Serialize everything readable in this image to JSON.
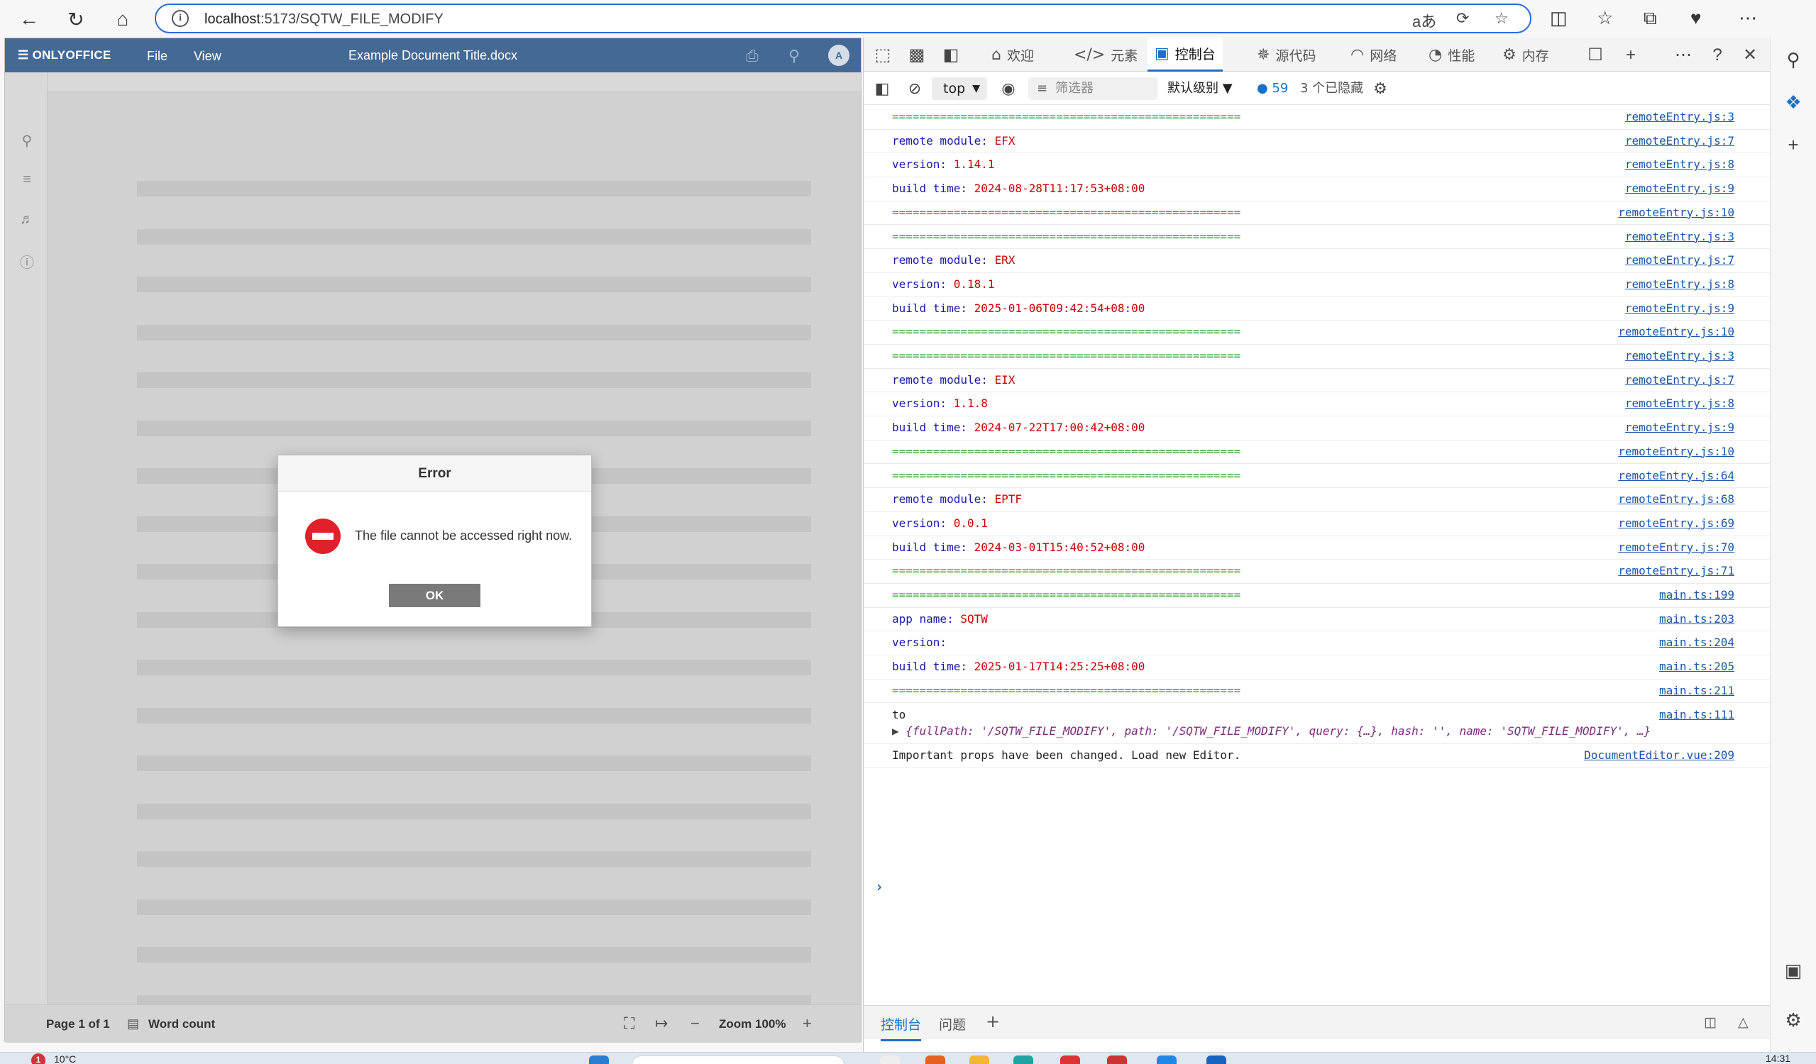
{
  "browser": {
    "url_host": "localhost",
    "url_path": ":5173/SQTW_FILE_MODIFY"
  },
  "editor": {
    "brand": "ONLYOFFICE",
    "menu": [
      "File",
      "View"
    ],
    "doc_title": "Example Document Title.docx",
    "avatar": "A",
    "status": {
      "page": "Page 1 of 1",
      "word_count": "Word count",
      "zoom": "Zoom 100%"
    },
    "doc_line_count": 19
  },
  "dialog": {
    "title": "Error",
    "message": "The file cannot be accessed right now.",
    "ok": "OK"
  },
  "devtools": {
    "tabs": [
      {
        "label": "欢迎",
        "icon": "home-icon"
      },
      {
        "label": "元素",
        "icon": "code-icon"
      },
      {
        "label": "控制台",
        "icon": "console-icon",
        "active": true
      },
      {
        "label": "源代码",
        "icon": "bug-icon"
      },
      {
        "label": "网络",
        "icon": "wifi-icon"
      },
      {
        "label": "性能",
        "icon": "gauge-icon"
      },
      {
        "label": "内存",
        "icon": "gear-icon"
      }
    ],
    "toolbar": {
      "context": "top",
      "filter_placeholder": "筛选器",
      "level": "默认级别",
      "message_count": "59",
      "hidden": "3 个已隐藏"
    },
    "console": [
      {
        "kind": "sep",
        "text": "===================================================",
        "src": "remoteEntry.js:3"
      },
      {
        "kind": "kv",
        "key": "remote module: ",
        "val": "EFX",
        "src": "remoteEntry.js:7"
      },
      {
        "kind": "kv",
        "key": "version: ",
        "val": "1.14.1",
        "src": "remoteEntry.js:8"
      },
      {
        "kind": "kv",
        "key": "build time: ",
        "val": "2024-08-28T11:17:53+08:00",
        "src": "remoteEntry.js:9"
      },
      {
        "kind": "sep",
        "text": "===================================================",
        "src": "remoteEntry.js:10"
      },
      {
        "kind": "sep",
        "text": "===================================================",
        "src": "remoteEntry.js:3"
      },
      {
        "kind": "kv",
        "key": "remote module: ",
        "val": "ERX",
        "src": "remoteEntry.js:7"
      },
      {
        "kind": "kv",
        "key": "version: ",
        "val": "0.18.1",
        "src": "remoteEntry.js:8"
      },
      {
        "kind": "kv",
        "key": "build time: ",
        "val": "2025-01-06T09:42:54+08:00",
        "src": "remoteEntry.js:9"
      },
      {
        "kind": "sep",
        "text": "===================================================",
        "src": "remoteEntry.js:10"
      },
      {
        "kind": "sep",
        "text": "===================================================",
        "src": "remoteEntry.js:3"
      },
      {
        "kind": "kv",
        "key": "remote module: ",
        "val": "EIX",
        "src": "remoteEntry.js:7"
      },
      {
        "kind": "kv",
        "key": "version: ",
        "val": "1.1.8",
        "src": "remoteEntry.js:8"
      },
      {
        "kind": "kv",
        "key": "build time: ",
        "val": "2024-07-22T17:00:42+08:00",
        "src": "remoteEntry.js:9"
      },
      {
        "kind": "sep",
        "text": "===================================================",
        "src": "remoteEntry.js:10"
      },
      {
        "kind": "sep",
        "text": "===================================================",
        "src": "remoteEntry.js:64"
      },
      {
        "kind": "kv",
        "key": "remote module: ",
        "val": "EPTF",
        "src": "remoteEntry.js:68"
      },
      {
        "kind": "kv",
        "key": "version: ",
        "val": "0.0.1",
        "src": "remoteEntry.js:69"
      },
      {
        "kind": "kv",
        "key": "build time: ",
        "val": "2024-03-01T15:40:52+08:00",
        "src": "remoteEntry.js:70"
      },
      {
        "kind": "sep",
        "text": "===================================================",
        "src": "remoteEntry.js:71"
      },
      {
        "kind": "sep",
        "text": "===================================================",
        "src": "main.ts:199"
      },
      {
        "kind": "kv",
        "key": "app name: ",
        "val": "SQTW",
        "src": "main.ts:203"
      },
      {
        "kind": "kv",
        "key": "version: ",
        "val": "",
        "src": "main.ts:204"
      },
      {
        "kind": "kv",
        "key": "build time: ",
        "val": "2025-01-17T14:25:25+08:00",
        "src": "main.ts:205"
      },
      {
        "kind": "sep",
        "text": "===================================================",
        "src": "main.ts:211"
      },
      {
        "kind": "obj",
        "text": "to",
        "obj": "{fullPath: '/SQTW_FILE_MODIFY', path: '/SQTW_FILE_MODIFY', query: {…}, hash: '', name: 'SQTW_FILE_MODIFY', …}",
        "src": "main.ts:111"
      },
      {
        "kind": "plain",
        "text": "Important props have been changed. Load new Editor.",
        "src": "DocumentEditor.vue:209"
      }
    ],
    "bottom_tabs": [
      "控制台",
      "问题"
    ]
  },
  "taskbar": {
    "temp": "10°C",
    "badge": "1",
    "time": "14:31"
  }
}
